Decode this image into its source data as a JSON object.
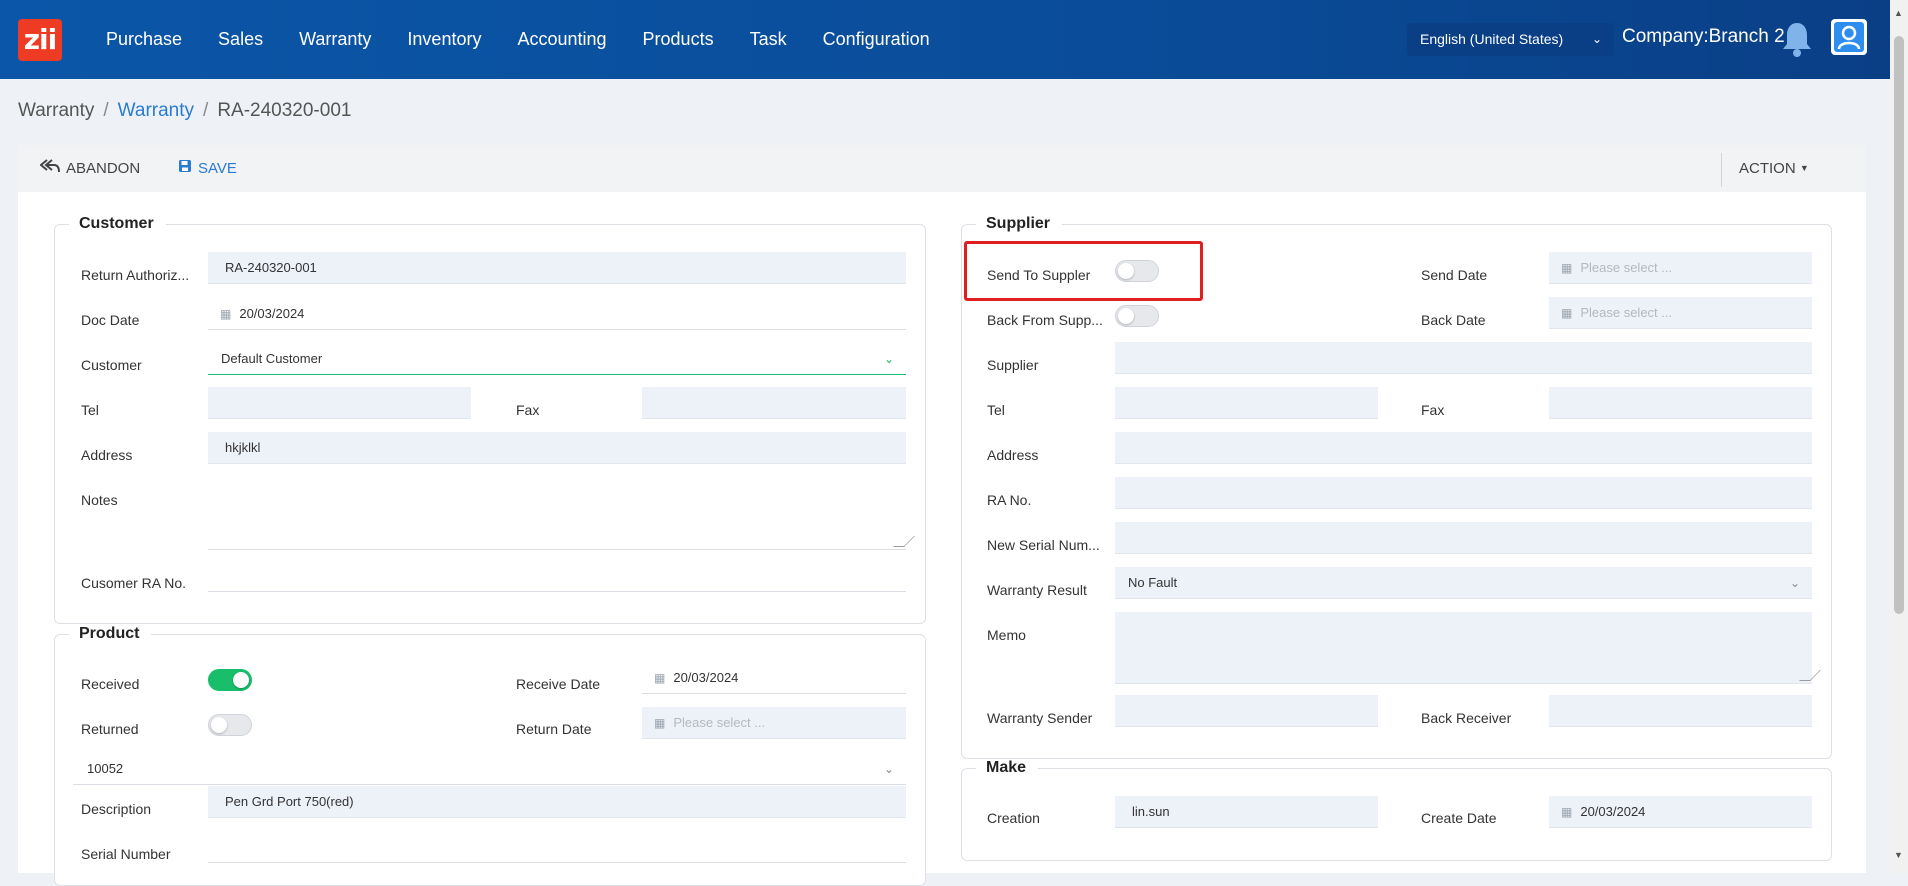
{
  "nav": {
    "logo": "zii",
    "items": [
      "Purchase",
      "Sales",
      "Warranty",
      "Inventory",
      "Accounting",
      "Products",
      "Task",
      "Configuration"
    ],
    "language": "English (United States)",
    "company": "Company:Branch 2"
  },
  "breadcrumb": {
    "root": "Warranty",
    "link": "Warranty",
    "current": "RA-240320-001",
    "sep": "/"
  },
  "toolbar": {
    "abandon": "ABANDON",
    "save": "SAVE",
    "action": "ACTION"
  },
  "customer": {
    "title": "Customer",
    "return_auth_label": "Return Authoriz...",
    "return_auth_value": "RA-240320-001",
    "doc_date_label": "Doc Date",
    "doc_date_value": "20/03/2024",
    "customer_label": "Customer",
    "customer_value": "Default Customer",
    "tel_label": "Tel",
    "fax_label": "Fax",
    "address_label": "Address",
    "address_value": "hkjklkl",
    "notes_label": "Notes",
    "ra_no_label": "Cusomer RA No."
  },
  "product": {
    "title": "Product",
    "received_label": "Received",
    "received_on": true,
    "receive_date_label": "Receive Date",
    "receive_date_value": "20/03/2024",
    "returned_label": "Returned",
    "returned_on": false,
    "return_date_label": "Return Date",
    "return_date_placeholder": "Please select ...",
    "product_code": "10052",
    "description_label": "Description",
    "description_value": "Pen Grd Port 750(red)",
    "serial_label": "Serial Number"
  },
  "supplier": {
    "title": "Supplier",
    "send_label": "Send To Suppler",
    "send_on": false,
    "send_date_label": "Send Date",
    "send_date_placeholder": "Please select ...",
    "back_label": "Back From Supp...",
    "back_on": false,
    "back_date_label": "Back Date",
    "back_date_placeholder": "Please select ...",
    "supplier_label": "Supplier",
    "tel_label": "Tel",
    "fax_label": "Fax",
    "address_label": "Address",
    "ra_no_label": "RA No.",
    "new_serial_label": "New Serial Num...",
    "warranty_result_label": "Warranty Result",
    "warranty_result_value": "No Fault",
    "memo_label": "Memo",
    "sender_label": "Warranty Sender",
    "receiver_label": "Back Receiver"
  },
  "make": {
    "title": "Make",
    "creation_label": "Creation",
    "creation_value": "lin.sun",
    "create_date_label": "Create Date",
    "create_date_value": "20/03/2024"
  },
  "colors": {
    "nav_bg": "#0b56a8",
    "accent": "#2a7bd1",
    "toggle_on": "#19be6b",
    "highlight": "#e02020",
    "logo_bg": "#ee3b24"
  },
  "icons": [
    "calendar-icon",
    "chevron-down-icon",
    "bell-icon",
    "user-avatar-icon",
    "reply-all-icon",
    "save-icon",
    "caret-down-icon"
  ]
}
